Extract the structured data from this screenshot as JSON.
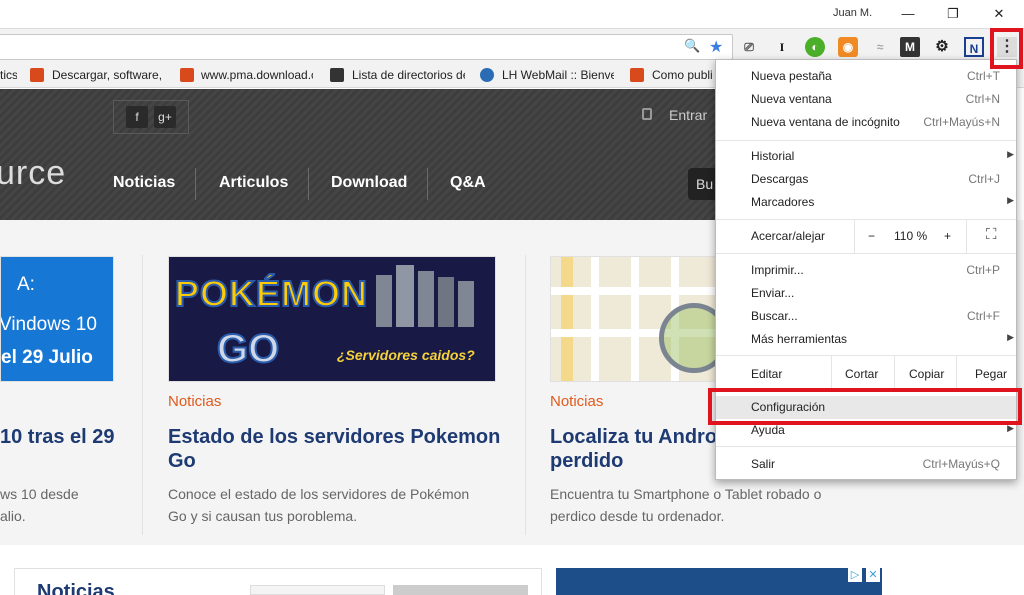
{
  "titlebar": {
    "user": "Juan M.",
    "minimize": "—",
    "restore": "❐",
    "close": "✕"
  },
  "toolbar": {
    "zoom_glyph": "🔍",
    "star_glyph": "★",
    "cast_glyph": "⎚",
    "ext1": "I",
    "ext2": "◐",
    "ext3": "◉",
    "ext4": "≈",
    "ext5": "M",
    "ext6": "⚙",
    "ext7": "N",
    "menu_glyph": "⋮"
  },
  "bookmarks": [
    {
      "label": "tics",
      "color": ""
    },
    {
      "label": "Descargar, software, c",
      "color": "#d84a1b"
    },
    {
      "label": "www.pma.download.c",
      "color": "#d84a1b"
    },
    {
      "label": "Lista de directorios de",
      "color": "#333333"
    },
    {
      "label": "LH WebMail :: Bienve",
      "color": "#2a6db5"
    },
    {
      "label": "Como publi",
      "color": "#d84a1b"
    }
  ],
  "site": {
    "social_f": "f",
    "social_g": "g+",
    "logo": "urce",
    "login": "Entrar",
    "search_stub": "Bu",
    "nav": [
      "Noticias",
      "Articulos",
      "Download",
      "Q&A"
    ]
  },
  "articles": [
    {
      "img_line1": "A:",
      "img_line2": "Vindows 10",
      "img_line3": "el 29 Julio",
      "category": "",
      "title_line1": "10 tras el 29",
      "title_line2": "",
      "desc_line1": "ws 10 desde",
      "desc_line2": "alio."
    },
    {
      "img_main": "POKÉMON",
      "img_sub": "GO",
      "img_caption": "¿Servidores caidos?",
      "category": "Noticias",
      "title_line1": "Estado de los servidores Pokemon",
      "title_line2": "Go",
      "desc_line1": "Conoce el estado de los servidores de Pokémon",
      "desc_line2": "Go y si causan tus poroblema."
    },
    {
      "category": "Noticias",
      "title_line1": "Localiza tu Andro",
      "title_line2": "perdido",
      "desc_line1": "Encuentra tu Smartphone o Tablet robado o",
      "desc_line2": "perdico desde tu ordenador."
    }
  ],
  "bottom": {
    "heading": "Noticias"
  },
  "menu": {
    "group1": [
      {
        "label": "Nueva pestaña",
        "shortcut": "Ctrl+T"
      },
      {
        "label": "Nueva ventana",
        "shortcut": "Ctrl+N"
      },
      {
        "label": "Nueva ventana de incógnito",
        "shortcut": "Ctrl+Mayús+N"
      }
    ],
    "group2": [
      {
        "label": "Historial",
        "shortcut": ""
      },
      {
        "label": "Descargas",
        "shortcut": "Ctrl+J"
      },
      {
        "label": "Marcadores",
        "shortcut": ""
      }
    ],
    "zoom": {
      "label": "Acercar/alejar",
      "minus": "−",
      "value": "110 %",
      "plus": "+",
      "fullscreen": "⛶"
    },
    "group3": [
      {
        "label": "Imprimir...",
        "shortcut": "Ctrl+P"
      },
      {
        "label": "Enviar...",
        "shortcut": ""
      },
      {
        "label": "Buscar...",
        "shortcut": "Ctrl+F"
      },
      {
        "label": "Más herramientas",
        "shortcut": ""
      }
    ],
    "edit": {
      "label": "Editar",
      "cut": "Cortar",
      "copy": "Copiar",
      "paste": "Pegar"
    },
    "group4": [
      {
        "label": "Configuración",
        "shortcut": ""
      },
      {
        "label": "Ayuda",
        "shortcut": ""
      }
    ],
    "exit": {
      "label": "Salir",
      "shortcut": "Ctrl+Mayús+Q"
    },
    "submenu_arrow": "▶"
  },
  "colors": {
    "highlight": "#e0141e",
    "link": "#1e3a73",
    "category": "#e05a1c"
  }
}
